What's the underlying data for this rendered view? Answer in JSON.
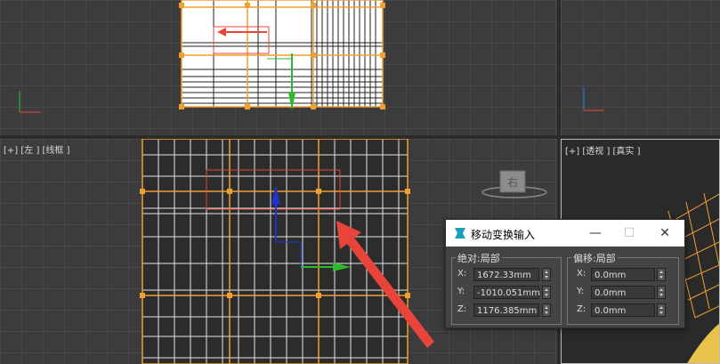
{
  "viewports": {
    "left_label": "[+] [左 ] [线框 ]",
    "persp_label": "[+] [透视 ] [真实 ]"
  },
  "viewcube": {
    "face_label": "右"
  },
  "dialog": {
    "title": "移动变换输入",
    "absolute_group": {
      "title": "绝对:局部",
      "x_label": "X:",
      "x_value": "1672.33mm",
      "y_label": "Y:",
      "y_value": "-1010.051mm",
      "z_label": "Z:",
      "z_value": "1176.385mm"
    },
    "offset_group": {
      "title": "偏移:局部",
      "x_label": "X:",
      "x_value": "0.0mm",
      "y_label": "Y:",
      "y_value": "0.0mm",
      "z_label": "Z:",
      "z_value": "0.0mm"
    }
  },
  "colors": {
    "selection": "#f0a030",
    "annotation_arrow": "#e8443a",
    "wireframe": "#ffffff",
    "viewport_bg": "#3c3c3c"
  }
}
